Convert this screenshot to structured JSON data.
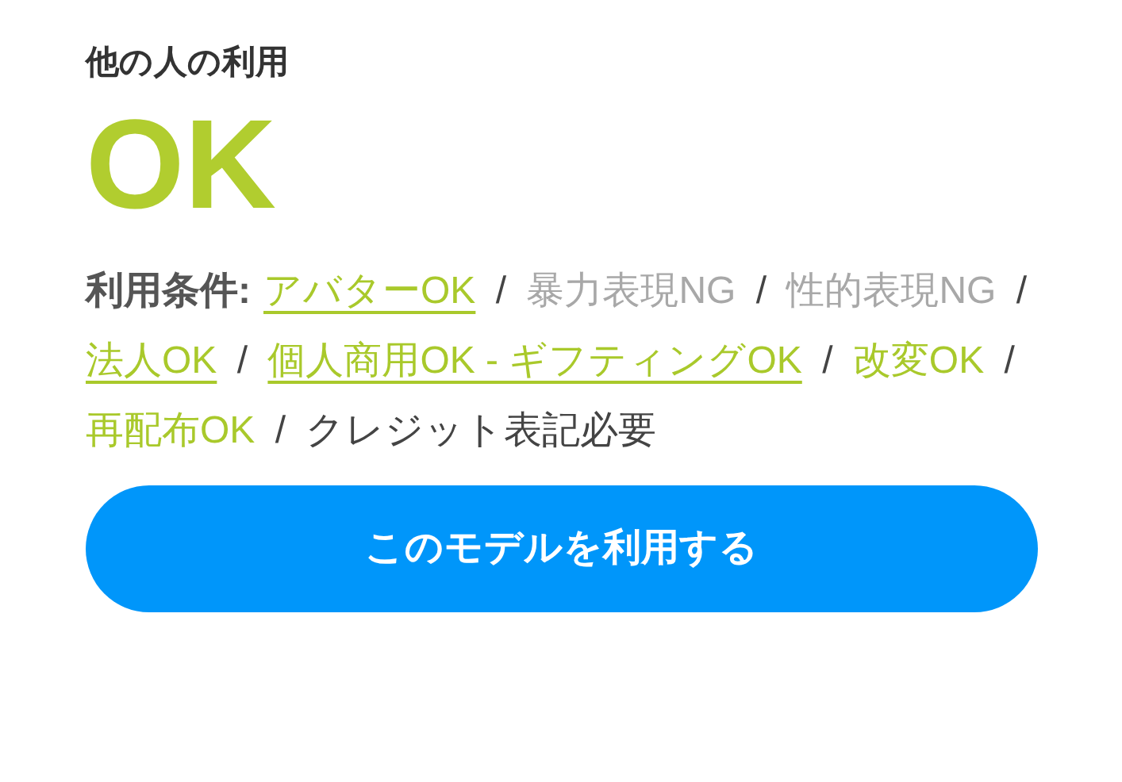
{
  "heading": "他の人の利用",
  "verdict": {
    "text": "OK",
    "kind": "ok"
  },
  "conditions": {
    "label": "利用条件:",
    "items": [
      {
        "text": "アバターOK",
        "kind": "link"
      },
      {
        "text": "/",
        "kind": "separator"
      },
      {
        "text": "暴力表現NG",
        "kind": "ng"
      },
      {
        "text": "/",
        "kind": "separator"
      },
      {
        "text": "性的表現NG",
        "kind": "ng"
      },
      {
        "text": "/",
        "kind": "separator"
      },
      {
        "text": "法人OK",
        "kind": "link"
      },
      {
        "text": "/",
        "kind": "separator"
      },
      {
        "text": "個人商用OK - ギフティングOK",
        "kind": "link"
      },
      {
        "text": "/",
        "kind": "separator"
      },
      {
        "text": "改変OK",
        "kind": "ok"
      },
      {
        "text": "/",
        "kind": "separator"
      },
      {
        "text": "再配布OK",
        "kind": "ok"
      },
      {
        "text": "/",
        "kind": "separator"
      },
      {
        "text": "クレジット表記必要",
        "kind": "plain"
      }
    ]
  },
  "button": "このモデルを利用する"
}
